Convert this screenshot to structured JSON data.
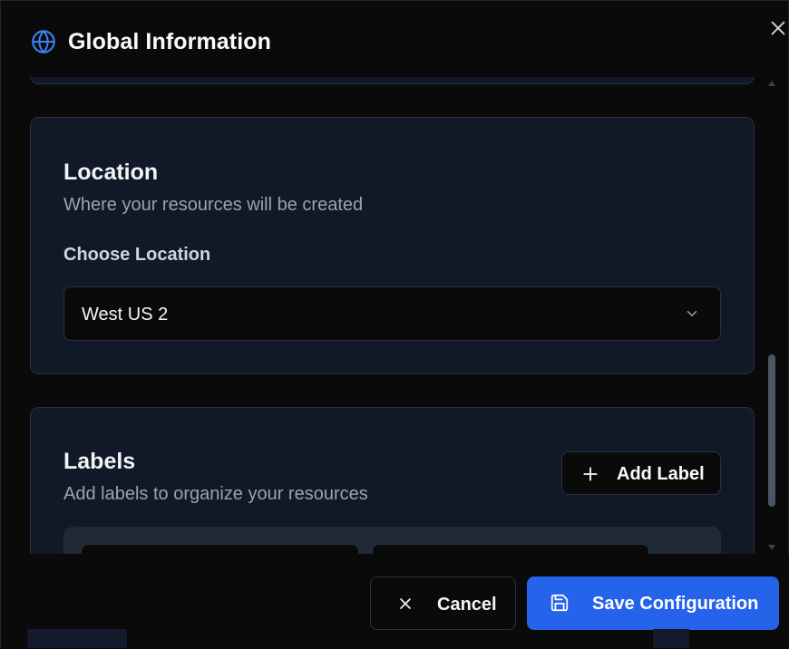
{
  "dialog": {
    "title": "Global Information",
    "icons": {
      "title": "globe-icon",
      "close": "close-icon"
    }
  },
  "location_card": {
    "heading": "Location",
    "subtitle": "Where your resources will be created",
    "field_label": "Choose Location",
    "selected_value": "West US 2",
    "select_icon": "chevron-down-icon"
  },
  "labels_card": {
    "heading": "Labels",
    "subtitle": "Add labels to organize your resources",
    "add_button_label": "Add Label",
    "add_button_icon": "plus-icon"
  },
  "footer": {
    "cancel_label": "Cancel",
    "cancel_icon": "x-icon",
    "save_label": "Save Configuration",
    "save_icon": "save-icon"
  },
  "colors": {
    "accent": "#2563eb",
    "card_bg": "#111827",
    "page_bg": "#0a0a0a"
  }
}
